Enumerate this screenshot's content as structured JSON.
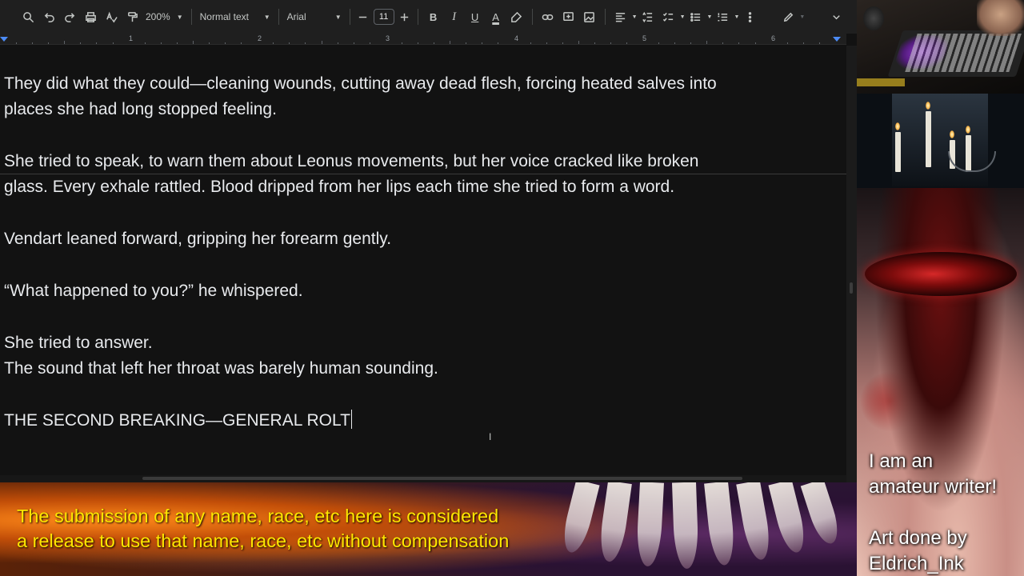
{
  "toolbar": {
    "zoom": "200%",
    "style": "Normal text",
    "font": "Arial",
    "font_size": "11",
    "bold": "B",
    "italic": "I",
    "underline": "U",
    "text_color": "A"
  },
  "ruler": {
    "numbers": [
      "1",
      "2",
      "3",
      "4",
      "5",
      "6"
    ]
  },
  "document": {
    "paragraphs": [
      "They did what they could—cleaning wounds, cutting away dead flesh, forcing heated salves into",
      "places she had long stopped feeling.",
      "She tried to speak, to warn them about Leonus movements, but her voice cracked like broken",
      "glass. Every exhale rattled. Blood dripped from her lips each time she tried to form a word.",
      "Vendart leaned forward, gripping her forearm gently.",
      "“What happened to you?” he whispered.",
      "She tried to answer.",
      "The sound that left her throat was barely human sounding.",
      "THE SECOND BREAKING—GENERAL ROLT"
    ]
  },
  "overlay": {
    "disclaimer_line1": "The submission of any name, race, etc here is considered",
    "disclaimer_line2": "a release to use that name, race, etc without compensation",
    "credits_line1": "I am an",
    "credits_line2": "amateur writer!",
    "credits_line3": "Art done by",
    "credits_line4": "Eldrich_Ink"
  },
  "colors": {
    "doc_background": "#121212",
    "toolbar_background": "#1f1f1f",
    "text": "#e8eaed",
    "disclaimer": "#ffe600",
    "ruler_marker": "#4c8bf5"
  }
}
